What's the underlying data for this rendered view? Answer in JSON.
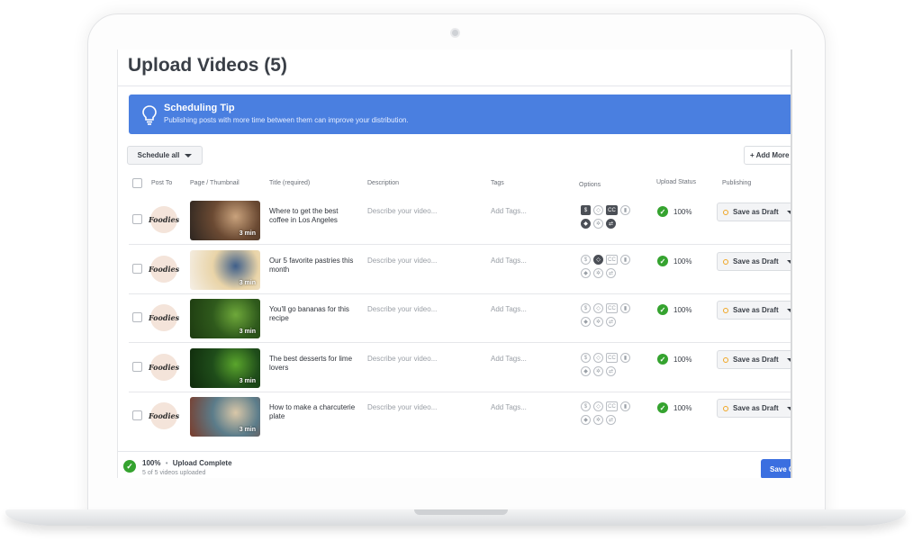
{
  "page": {
    "title": "Upload Videos (5)"
  },
  "tip": {
    "title": "Scheduling Tip",
    "text": "Publishing posts with more time between them can improve your distribution."
  },
  "toolbar": {
    "schedule_all_label": "Schedule all",
    "add_more_label": "+ Add More"
  },
  "columns": {
    "post_to": "Post To",
    "page_thumbnail": "Page / Thumbnail",
    "title": "Title (required)",
    "description": "Description",
    "tags": "Tags",
    "options": "Options",
    "upload_status": "Upload Status",
    "publishing": "Publishing"
  },
  "rows": [
    {
      "page_logo": "Foodies",
      "duration": "3 min",
      "title": "Where to get the best coffee in Los Angeles",
      "description_placeholder": "Describe your video...",
      "tags_placeholder": "Add Tags...",
      "upload_percent": "100%",
      "publish_label": "Save as Draft",
      "thumb_colors": [
        "#6b4a33",
        "#c9a27c",
        "#2c2520"
      ]
    },
    {
      "page_logo": "Foodies",
      "duration": "3 min",
      "title": "Our 5 favorite pastries this month",
      "description_placeholder": "Describe your video...",
      "tags_placeholder": "Add Tags...",
      "upload_percent": "100%",
      "publish_label": "Save as Draft",
      "thumb_colors": [
        "#e9d4a8",
        "#3f5f8a",
        "#f5efe6"
      ]
    },
    {
      "page_logo": "Foodies",
      "duration": "3 min",
      "title": "You'll go bananas for this recipe",
      "description_placeholder": "Describe your video...",
      "tags_placeholder": "Add Tags...",
      "upload_percent": "100%",
      "publish_label": "Save as Draft",
      "thumb_colors": [
        "#2f5a1c",
        "#6ea83a",
        "#1d3a10"
      ]
    },
    {
      "page_logo": "Foodies",
      "duration": "3 min",
      "title": "The best desserts for lime lovers",
      "description_placeholder": "Describe your video...",
      "tags_placeholder": "Add Tags...",
      "upload_percent": "100%",
      "publish_label": "Save as Draft",
      "thumb_colors": [
        "#1f4d1a",
        "#5aa52c",
        "#0f2a0c"
      ]
    },
    {
      "page_logo": "Foodies",
      "duration": "3 min",
      "title": "How to make a charcuterie plate",
      "description_placeholder": "Describe your video...",
      "tags_placeholder": "Add Tags...",
      "upload_percent": "100%",
      "publish_label": "Save as Draft",
      "thumb_colors": [
        "#5b7c8a",
        "#d9c7a8",
        "#7a3b2a"
      ]
    }
  ],
  "footer": {
    "percent": "100%",
    "separator": "•",
    "status": "Upload Complete",
    "sub": "5 of 5 videos uploaded",
    "save_label": "Save Changes"
  },
  "colors": {
    "accent": "#4a7fe0",
    "success": "#35a32f",
    "draft_dot": "#f0a623"
  }
}
